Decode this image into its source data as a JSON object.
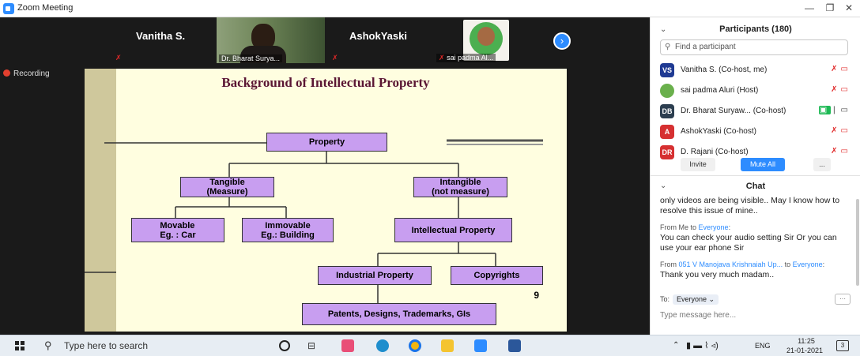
{
  "window": {
    "title": "Zoom Meeting"
  },
  "thumbnails": [
    {
      "name": "Vanitha S.",
      "muted": true
    },
    {
      "name": "Dr. Bharat Surya...",
      "video": true
    },
    {
      "name": "AshokYaski",
      "muted": true
    },
    {
      "name": "sai padma Al...",
      "video": true,
      "muted": true
    }
  ],
  "recording": {
    "label": "Recording"
  },
  "slide": {
    "title": "Background of Intellectual Property",
    "nodes": {
      "property": "Property",
      "tangible": [
        "Tangible",
        "(Measure)"
      ],
      "intangible": [
        "Intangible",
        "(not measure)"
      ],
      "movable": [
        "Movable",
        "Eg. : Car"
      ],
      "immovable": [
        "Immovable",
        "Eg.: Building"
      ],
      "intellectual": "Intellectual Property",
      "industrial": "Industrial Property",
      "copyrights": "Copyrights",
      "patents": "Patents, Designs, Trademarks, GIs"
    },
    "page_number": "9"
  },
  "participants": {
    "header": "Participants (180)",
    "search_placeholder": "Find a participant",
    "list": [
      {
        "initials": "VS",
        "name": "Vanitha S. (Co-host, me)",
        "color": "#1f3a93"
      },
      {
        "initials": "",
        "name": "sai padma Aluri (Host)",
        "color": "#6ab04c"
      },
      {
        "initials": "DB",
        "name": "Dr. Bharat Suryaw... (Co-host)",
        "color": "#2c3e50"
      },
      {
        "initials": "A",
        "name": "AshokYaski (Co-host)",
        "color": "#d63031"
      },
      {
        "initials": "DR",
        "name": "D. Rajani (Co-host)",
        "color": "#d63031"
      }
    ],
    "buttons": {
      "invite": "Invite",
      "mute_all": "Mute All",
      "more": "..."
    }
  },
  "chat": {
    "header": "Chat",
    "messages": [
      {
        "from": "",
        "to": "",
        "text": "only videos are being visible.. May I know how to resolve this issue of mine.."
      },
      {
        "from": "Me",
        "to": "Everyone",
        "text": "You can check your audio setting Sir Or you can use your ear phone Sir"
      },
      {
        "from": "051 V Manojava Krishnaiah Up...",
        "to": "Everyone",
        "text": "Thank you very much madam.."
      }
    ],
    "to_label": "To:",
    "recipient": "Everyone",
    "input_placeholder": "Type message here..."
  },
  "taskbar": {
    "search_placeholder": "Type here to search",
    "tray": {
      "lang": "ENG",
      "time": "11:25",
      "date": "21-01-2021",
      "notifications": "3"
    }
  },
  "colors": {
    "zoom_blue": "#2D8CFF",
    "slide_bg": "#fffee0",
    "node_fill": "#c89ef0",
    "title_color": "#5a1533",
    "muted_red": "#e02828"
  }
}
